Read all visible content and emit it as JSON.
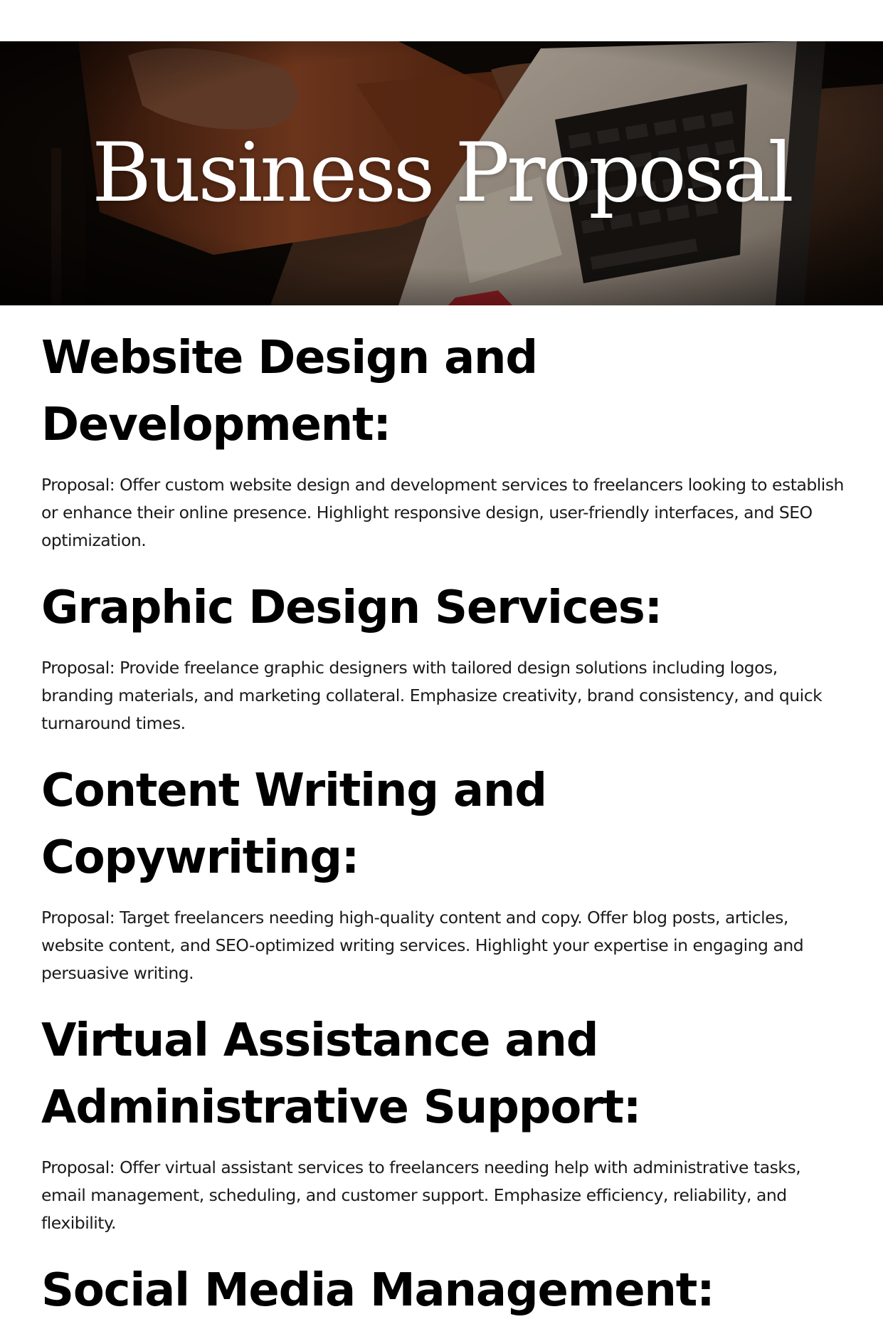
{
  "hero": {
    "title": "Business Proposal"
  },
  "sections": [
    {
      "heading": "Website Design and Development:",
      "body": "Proposal: Offer custom website design and development services to freelancers looking to establish or enhance their online presence. Highlight responsive design, user-friendly interfaces, and SEO optimization."
    },
    {
      "heading": "Graphic Design Services:",
      "body": "Proposal: Provide freelance graphic designers with tailored design solutions including logos, branding materials, and marketing collateral. Emphasize creativity, brand consistency, and quick turnaround times."
    },
    {
      "heading": "Content Writing and Copywriting:",
      "body": "Proposal: Target freelancers needing high-quality content and copy. Offer blog posts, articles, website content, and SEO-optimized writing services. Highlight your expertise in engaging and persuasive writing."
    },
    {
      "heading": "Virtual Assistance and Administrative Support:",
      "body": "Proposal: Offer virtual assistant services to freelancers needing help with administrative tasks, email management, scheduling, and customer support. Emphasize efficiency, reliability, and flexibility."
    },
    {
      "heading": "Social Media Management:",
      "body": ""
    }
  ],
  "colors": {
    "text": "#000000",
    "hero_bg": "#0d0906",
    "sleeve": "#7a3a1c",
    "laptop": "#b8aa9c",
    "desk": "#3a2619"
  }
}
